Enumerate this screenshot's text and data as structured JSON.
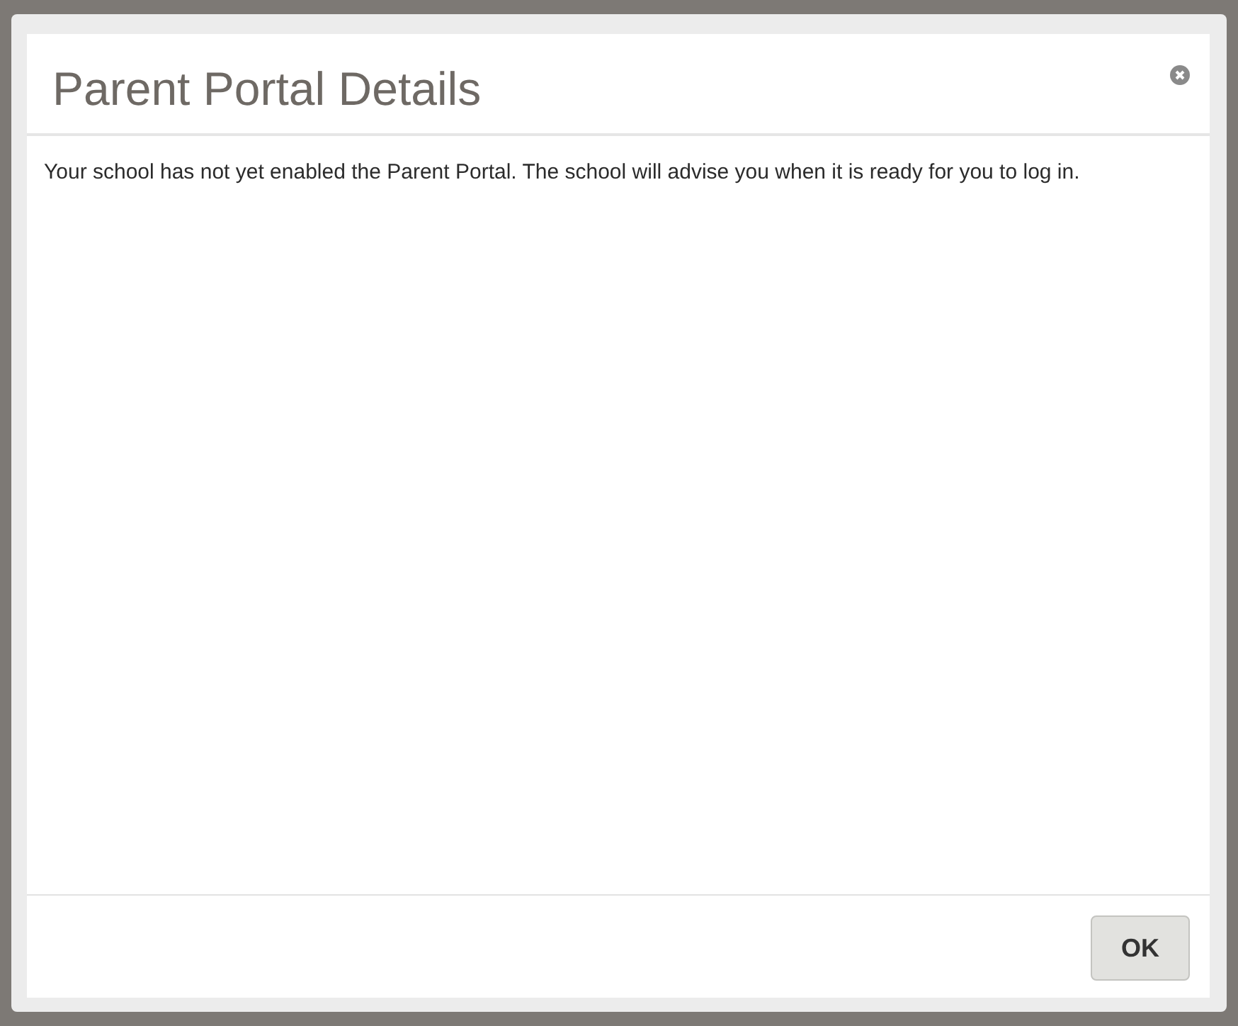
{
  "dialog": {
    "title": "Parent Portal Details",
    "message": "Your school has not yet enabled the Parent Portal. The school will advise you when it is ready for you to log in.",
    "buttons": [
      "OK"
    ]
  }
}
